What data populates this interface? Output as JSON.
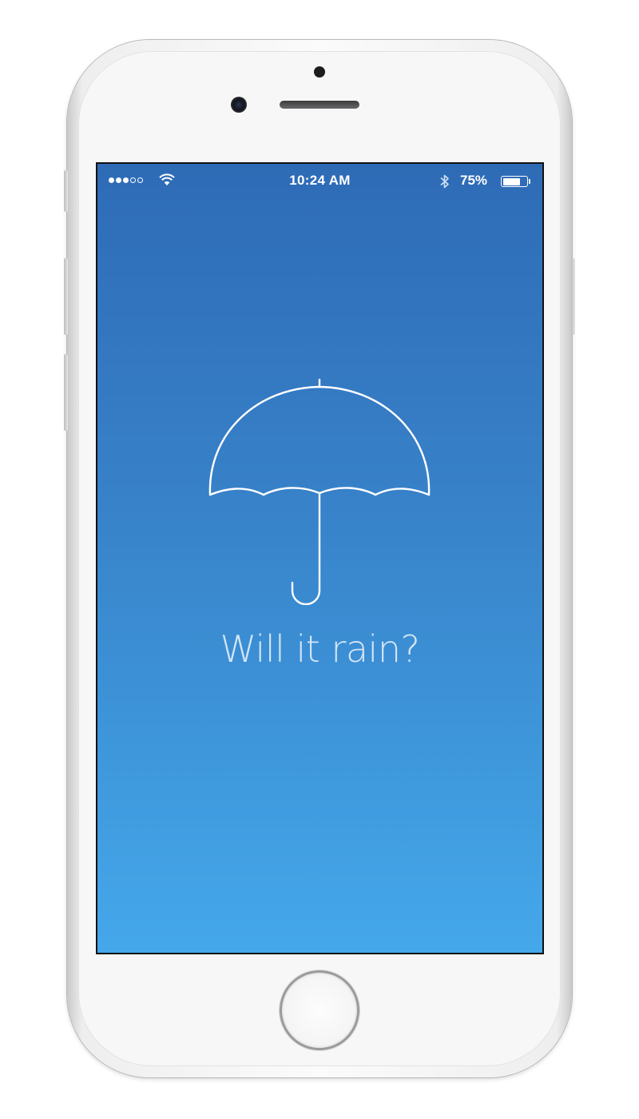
{
  "device": {
    "model": "iPhone",
    "color_body": "#f7f7f7"
  },
  "status_bar": {
    "signal_strength": 3,
    "signal_max": 5,
    "wifi": true,
    "time": "10:24 AM",
    "bluetooth": true,
    "battery_percent": "75%",
    "battery_level": 0.75
  },
  "main": {
    "icon": "umbrella-icon",
    "headline": "Will it rain?",
    "background_top": "#2e6bb6",
    "background_bottom": "#44a8ea"
  },
  "home_button": {
    "icon": "home-button"
  }
}
